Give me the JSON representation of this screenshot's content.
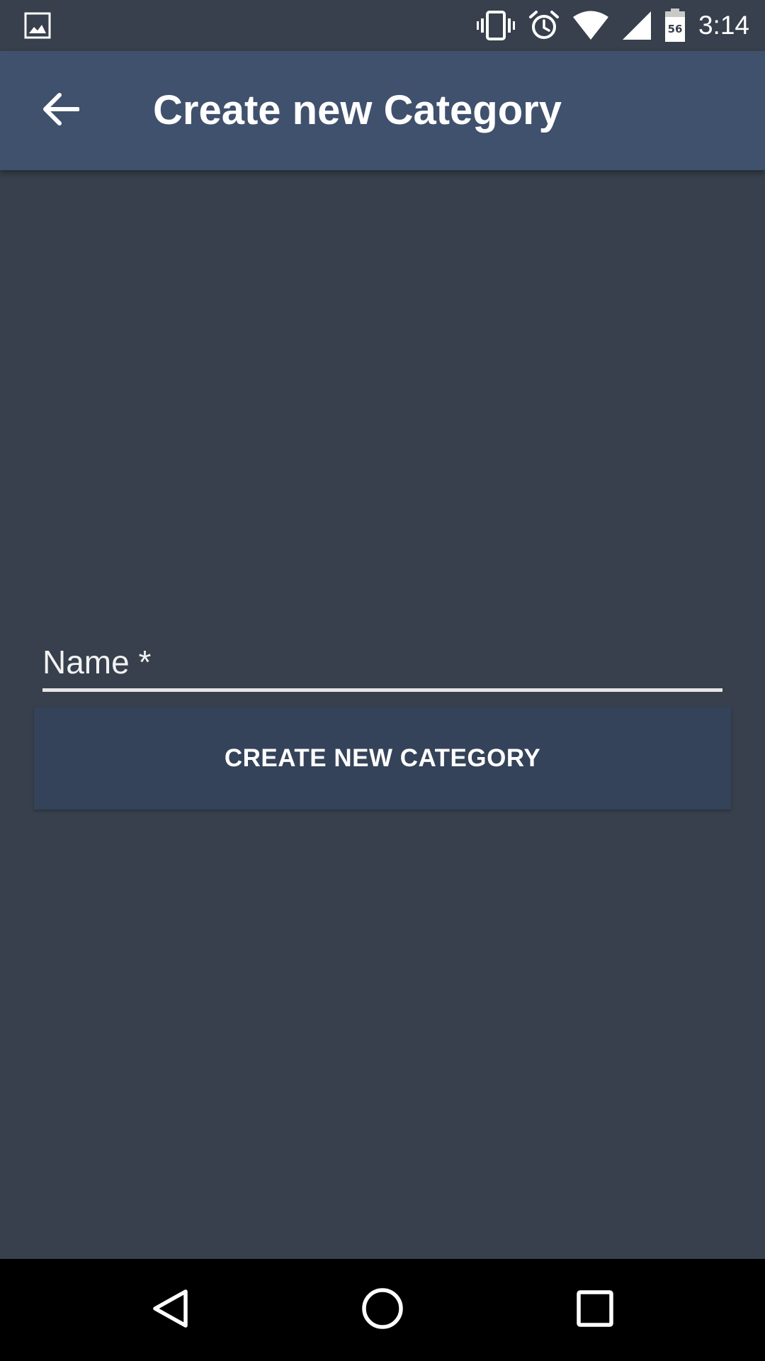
{
  "status_bar": {
    "time": "3:14",
    "battery_level": "56",
    "icons": [
      "image-notification-icon",
      "vibrate-icon",
      "alarm-icon",
      "wifi-icon",
      "cell-signal-icon",
      "battery-icon"
    ]
  },
  "app_bar": {
    "title": "Create new Category",
    "back_icon": "arrow-back-icon"
  },
  "form": {
    "name_placeholder": "Name *",
    "name_value": ""
  },
  "actions": {
    "create_label": "CREATE NEW CATEGORY"
  },
  "nav_bar": {
    "icons": [
      "back-triangle-icon",
      "home-circle-icon",
      "recents-square-icon"
    ]
  },
  "colors": {
    "background": "#37404c",
    "app_bar": "#40516d",
    "button": "#344359",
    "underline": "#e6e6e6",
    "nav_bar": "#000000"
  }
}
